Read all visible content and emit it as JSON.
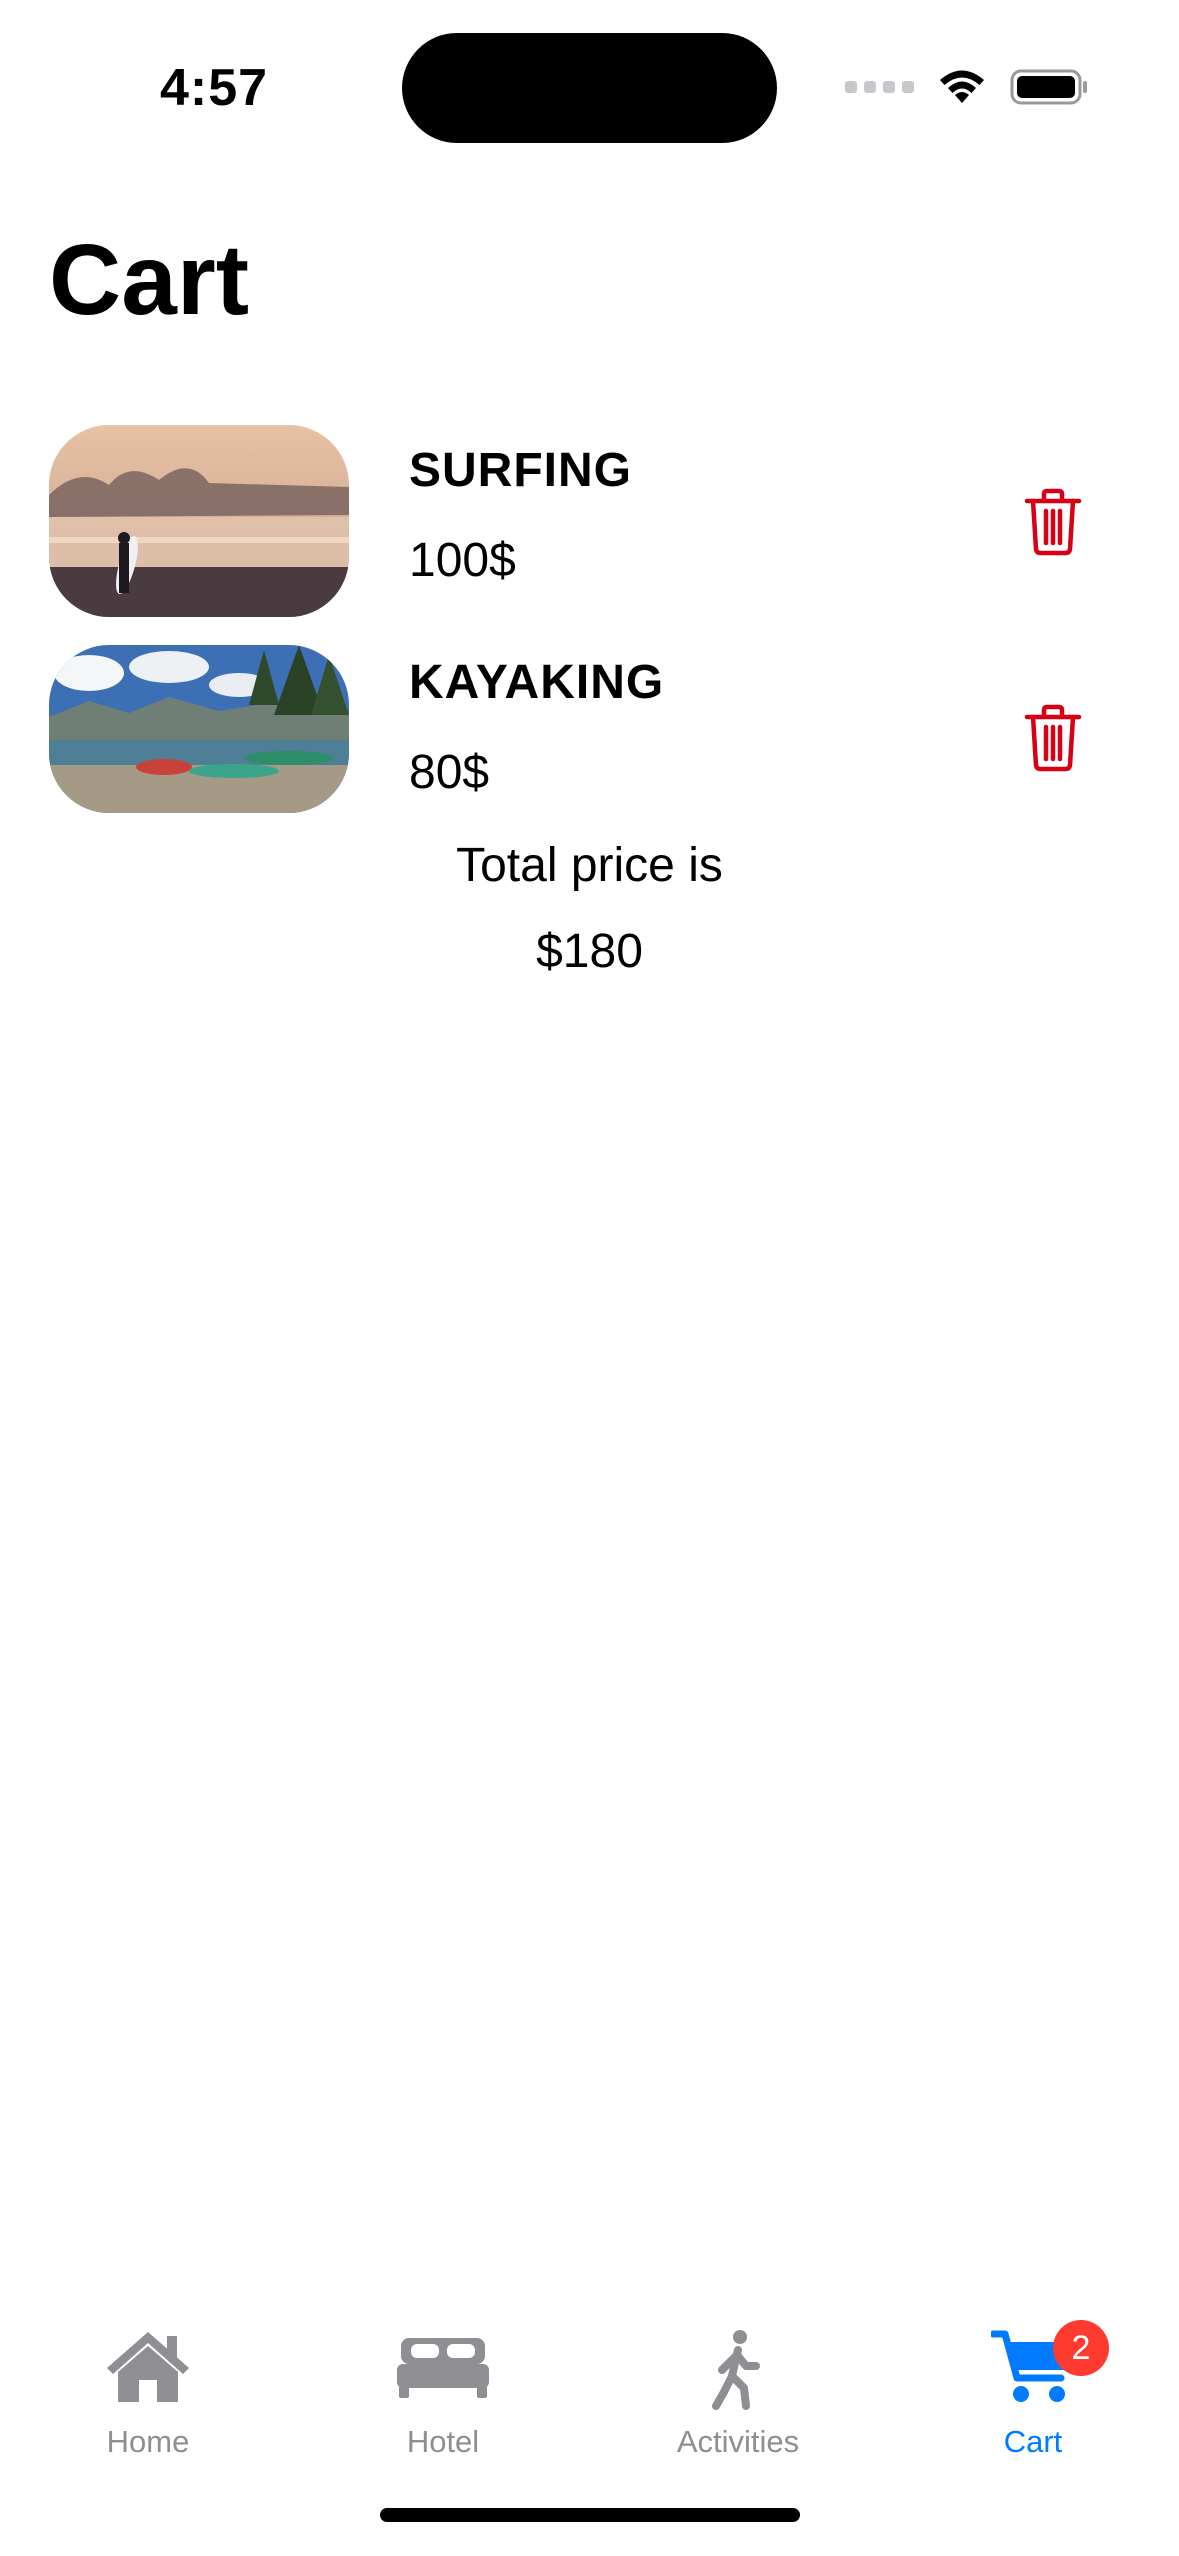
{
  "status_bar": {
    "time": "4:57"
  },
  "page": {
    "title": "Cart"
  },
  "cart_items": [
    {
      "name": "SURFING",
      "price": "100$",
      "image": "surfer-on-beach-photo",
      "delete_icon": "trash-icon"
    },
    {
      "name": "KAYAKING",
      "price": "80$",
      "image": "kayaks-on-lake-shore-photo",
      "delete_icon": "trash-icon"
    }
  ],
  "total": {
    "label": "Total price is",
    "value": "$180"
  },
  "tab_bar": {
    "tabs": [
      {
        "label": "Home",
        "icon": "house-icon",
        "active": false
      },
      {
        "label": "Hotel",
        "icon": "bed-icon",
        "active": false
      },
      {
        "label": "Activities",
        "icon": "figure-walk-icon",
        "active": false
      },
      {
        "label": "Cart",
        "icon": "cart-icon",
        "active": true,
        "badge": "2"
      }
    ]
  },
  "colors": {
    "accent": "#007aff",
    "inactive": "#8e8e93",
    "delete": "#d70015",
    "badge": "#ff3b30"
  }
}
